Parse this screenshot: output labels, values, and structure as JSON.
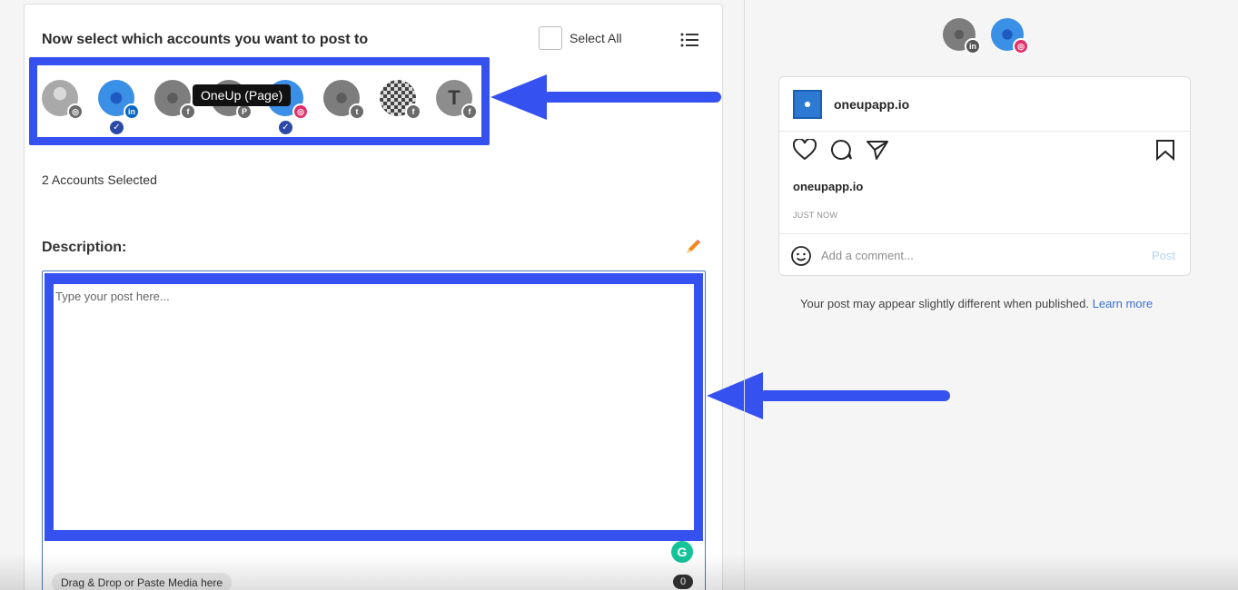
{
  "composer": {
    "heading": "Now select which accounts you want to post to",
    "select_all_label": "Select All",
    "tooltip": "OneUp (Page)",
    "accounts": [
      {
        "network": "instagram",
        "badge": "◎",
        "selected": false
      },
      {
        "network": "linkedin",
        "badge": "in",
        "selected": true
      },
      {
        "network": "facebook",
        "badge": "f",
        "selected": false
      },
      {
        "network": "pinterest",
        "badge": "P",
        "selected": false
      },
      {
        "network": "instagram",
        "badge": "◎",
        "selected": true
      },
      {
        "network": "twitter",
        "badge": "t",
        "selected": false
      },
      {
        "network": "facebook",
        "badge": "f",
        "selected": false
      },
      {
        "network": "facebook",
        "badge": "f",
        "selected": false,
        "initial": "T"
      }
    ],
    "selected_count_text": "2 Accounts Selected",
    "description_label": "Description:",
    "post_placeholder": "Type your post here...",
    "grammarly_glyph": "G",
    "drop_hint": "Drag & Drop or Paste Media here",
    "char_count": "0",
    "highlight_color": "#3551f0"
  },
  "preview": {
    "selected_badges": [
      "in",
      "◎"
    ],
    "account_name": "oneupapp.io",
    "caption_user": "oneupapp.io",
    "timestamp": "JUST NOW",
    "comment_placeholder": "Add a comment...",
    "post_button": "Post",
    "note_text": "Your post may appear slightly different when published.",
    "learn_more": "Learn more"
  }
}
